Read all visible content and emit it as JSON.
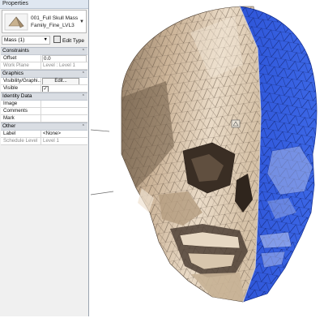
{
  "palette": {
    "title": "Properties",
    "type_selector": {
      "family_line1": "001_Full Skull Mass",
      "family_line2": "Family_Fine_LVL3"
    },
    "instance_filter": "Mass (1)",
    "edit_type_label": "Edit Type",
    "sections": [
      {
        "name": "Constraints",
        "rows": [
          {
            "label": "Offset",
            "value": "0.0",
            "kind": "input"
          },
          {
            "label": "Work Plane",
            "value": "Level : Level 1",
            "kind": "gray"
          }
        ]
      },
      {
        "name": "Graphics",
        "rows": [
          {
            "label": "Visibility/Graphi...",
            "value": "Edit...",
            "kind": "button"
          },
          {
            "label": "Visible",
            "value": "✓",
            "kind": "check"
          }
        ]
      },
      {
        "name": "Identity Data",
        "rows": [
          {
            "label": "Image",
            "value": "",
            "kind": "text"
          },
          {
            "label": "Comments",
            "value": "",
            "kind": "text"
          },
          {
            "label": "Mark",
            "value": "",
            "kind": "text"
          }
        ]
      },
      {
        "name": "Other",
        "rows": [
          {
            "label": "Label",
            "value": "<None>",
            "kind": "text"
          },
          {
            "label": "Schedule Level",
            "value": "Level 1",
            "kind": "gray"
          }
        ]
      }
    ]
  },
  "viewport": {
    "model_description": "3D mesh skull mass, right side highlighted (selected) in blue",
    "colors": {
      "bone": "#d9c5ad",
      "bone_dark": "#8a7560",
      "selection": "#3a5fd0",
      "mesh_line": "#4b3d30"
    }
  },
  "icons": [
    "mass-thumbnail-icon",
    "dropdown-arrow-icon",
    "edit-type-icon",
    "collapse-chevron-icon",
    "checkbox-icon"
  ]
}
